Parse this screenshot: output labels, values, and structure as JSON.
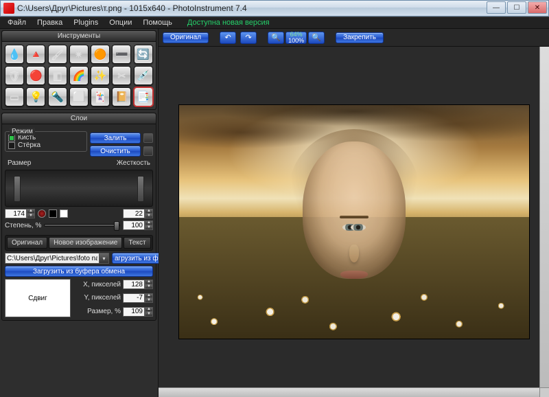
{
  "window": {
    "title": "C:\\Users\\Друг\\Pictures\\т.png - 1015x640 - PhotoInstrument 7.4"
  },
  "menubar": {
    "items": [
      "Файл",
      "Правка",
      "Plugins",
      "Опции",
      "Помощь"
    ],
    "update": "Доступна новая версия"
  },
  "tools": {
    "panel_title": "Инструменты",
    "items": [
      "liquify-drop",
      "sharpen-cone",
      "brush",
      "dodge",
      "stamp",
      "line",
      "rotate",
      "shield-hue",
      "redeye",
      "gradient",
      "rainbow",
      "glow",
      "scissors",
      "color-picker",
      "rect",
      "lightbulb",
      "cfl-bulb",
      "eraser",
      "cards",
      "book",
      "layers"
    ],
    "selected_index": 20
  },
  "layers": {
    "panel_title": "Слои",
    "mode_legend": "Режим",
    "brush_check": "Кисть",
    "eraser_check": "Стёрка",
    "fill_btn": "Залить",
    "clear_btn": "Очистить",
    "size_label": "Размер",
    "hardness_label": "Жесткость",
    "size_value": "174",
    "hardness_value": "22",
    "degree_label": "Степень, %",
    "degree_value": "100",
    "tabs": {
      "original": "Оригинал",
      "newimg": "Новое изображение",
      "text": "Текст"
    },
    "path_value": "C:\\Users\\Друг\\Pictures\\foto na ",
    "load_from_file": "агрузить из фай",
    "load_from_clipboard": "Загрузить из буфера обмена",
    "shift_btn": "Сдвиг",
    "x_px_label": "X, пикселей",
    "y_px_label": "Y, пикселей",
    "scale_label": "Размер, %",
    "x_value": "128",
    "y_value": "-7",
    "scale_value": "109"
  },
  "topbar": {
    "original": "Оригинал",
    "zoom_top": "64%",
    "zoom_bot": "100%",
    "pin": "Закрепить"
  }
}
